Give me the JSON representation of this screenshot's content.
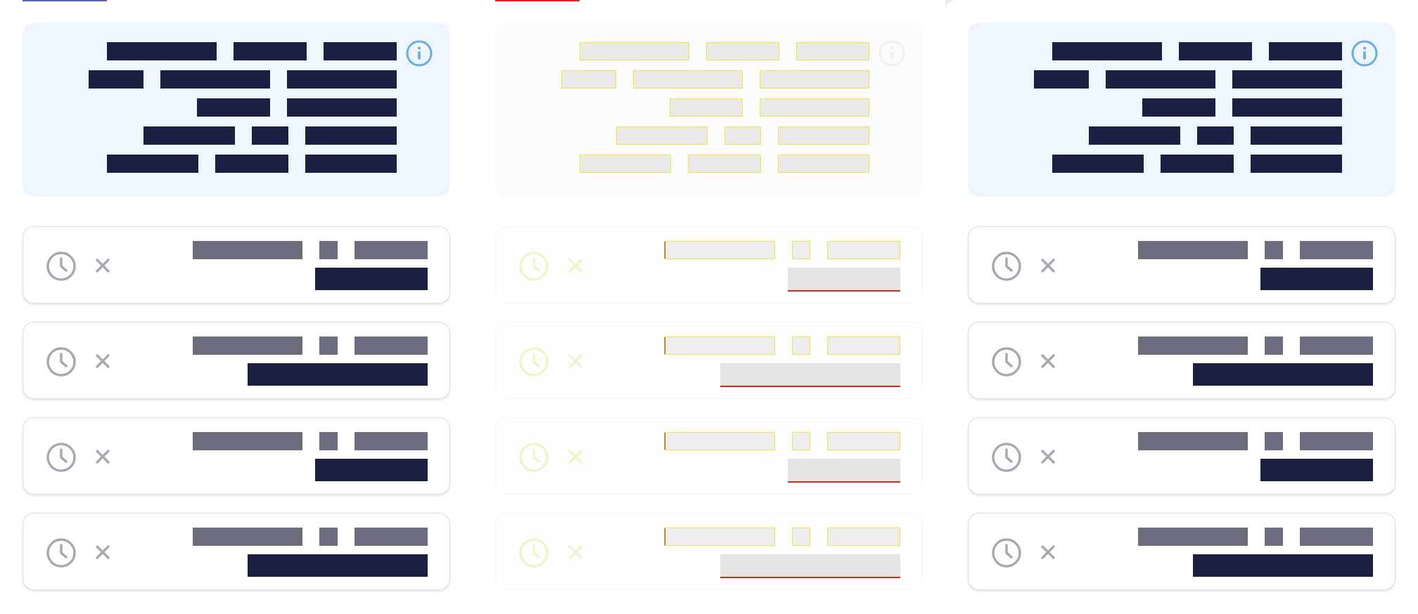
{
  "colors": {
    "info_card_bg": "#eef5fd",
    "info_icon": "#64aef0",
    "redacted_text_dark": "#1b2040",
    "redacted_text_gray": "#6c6e80",
    "icon_gray": "#a7a8b4",
    "ghost_outline": "#f2e83a",
    "ghost_marker": "#e02020",
    "panel_a_topbar": "#5b62c9",
    "panel_b_topbar": "#e02020"
  },
  "icons": {
    "info": "info-icon",
    "clock": "clock-icon",
    "remove": "close-icon"
  },
  "panels": [
    {
      "variant": "normal",
      "info_lines": [
        [
          "███████████",
          "███████",
          "███████"
        ],
        [
          "█████",
          "███████████",
          "████████████"
        ],
        [
          "██████████",
          "███████████"
        ],
        [
          "█████████",
          "███",
          "███████████"
        ],
        [
          "█████████",
          "███████",
          "█████████"
        ]
      ],
      "history": [
        {
          "meta": [
            "██████████",
            "█",
            "███████"
          ],
          "result": "███████████"
        },
        {
          "meta": [
            "██████████",
            "█",
            "███████"
          ],
          "result": "██████████████████"
        },
        {
          "meta": [
            "██████████",
            "█",
            "███████"
          ],
          "result": "███████████"
        },
        {
          "meta": [
            "██████████",
            "█",
            "███████"
          ],
          "result": "██████████████████"
        }
      ]
    },
    {
      "variant": "ghost",
      "info_lines": [
        [
          "███████████",
          "███████",
          "███████"
        ],
        [
          "█████",
          "███████████",
          "████████████"
        ],
        [
          "██████████",
          "███████████"
        ],
        [
          "█████████",
          "███",
          "███████████"
        ],
        [
          "█████████",
          "███████",
          "█████████"
        ]
      ],
      "history": [
        {
          "meta": [
            "██████████",
            "█",
            "███████"
          ],
          "result": "███████████"
        },
        {
          "meta": [
            "██████████",
            "█",
            "███████"
          ],
          "result": "██████████████████"
        },
        {
          "meta": [
            "██████████",
            "█",
            "███████"
          ],
          "result": "███████████"
        },
        {
          "meta": [
            "██████████",
            "█",
            "███████"
          ],
          "result": "██████████████████"
        }
      ]
    },
    {
      "variant": "normal",
      "info_lines": [
        [
          "███████████",
          "███████",
          "███████"
        ],
        [
          "█████",
          "███████████",
          "████████████"
        ],
        [
          "██████████",
          "███████████"
        ],
        [
          "█████████",
          "███",
          "███████████"
        ],
        [
          "█████████",
          "███████",
          "█████████"
        ]
      ],
      "history": [
        {
          "meta": [
            "██████████",
            "█",
            "███████"
          ],
          "result": "███████████"
        },
        {
          "meta": [
            "██████████",
            "█",
            "███████"
          ],
          "result": "██████████████████"
        },
        {
          "meta": [
            "██████████",
            "█",
            "███████"
          ],
          "result": "███████████"
        },
        {
          "meta": [
            "██████████",
            "█",
            "███████"
          ],
          "result": "██████████████████"
        }
      ]
    }
  ]
}
